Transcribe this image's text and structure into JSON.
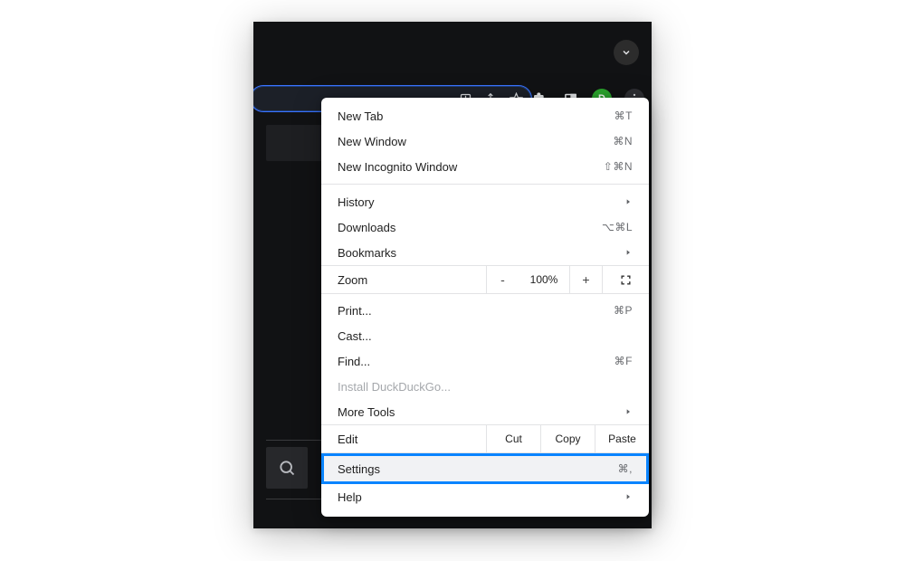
{
  "profile": {
    "initial": "D"
  },
  "menu": {
    "new_tab": {
      "label": "New Tab",
      "shortcut": "⌘T"
    },
    "new_window": {
      "label": "New Window",
      "shortcut": "⌘N"
    },
    "new_incognito": {
      "label": "New Incognito Window",
      "shortcut": "⇧⌘N"
    },
    "history": {
      "label": "History"
    },
    "downloads": {
      "label": "Downloads",
      "shortcut": "⌥⌘L"
    },
    "bookmarks": {
      "label": "Bookmarks"
    },
    "zoom": {
      "label": "Zoom",
      "percent": "100%",
      "minus": "-",
      "plus": "+"
    },
    "print": {
      "label": "Print...",
      "shortcut": "⌘P"
    },
    "cast": {
      "label": "Cast..."
    },
    "find": {
      "label": "Find...",
      "shortcut": "⌘F"
    },
    "install": {
      "label": "Install DuckDuckGo..."
    },
    "more_tools": {
      "label": "More Tools"
    },
    "edit": {
      "label": "Edit",
      "cut": "Cut",
      "copy": "Copy",
      "paste": "Paste"
    },
    "settings": {
      "label": "Settings",
      "shortcut": "⌘,"
    },
    "help": {
      "label": "Help"
    }
  }
}
